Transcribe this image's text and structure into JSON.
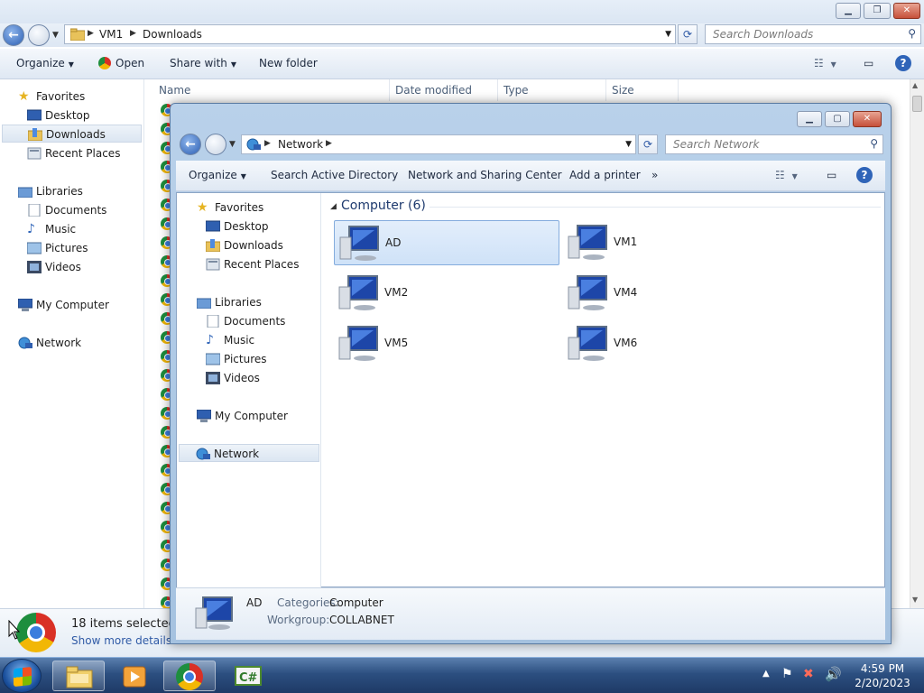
{
  "back_window": {
    "breadcrumb": [
      "VM1",
      "Downloads"
    ],
    "search_placeholder": "Search Downloads",
    "toolbar": {
      "organize": "Organize",
      "open": "Open",
      "share_with": "Share with",
      "new_folder": "New folder"
    },
    "nav": {
      "favorites": "Favorites",
      "desktop": "Desktop",
      "downloads": "Downloads",
      "recent_places": "Recent Places",
      "libraries": "Libraries",
      "documents": "Documents",
      "music": "Music",
      "pictures": "Pictures",
      "videos": "Videos",
      "my_computer": "My Computer",
      "network": "Network"
    },
    "columns": {
      "name": "Name",
      "date_modified": "Date modified",
      "type": "Type",
      "size": "Size"
    },
    "file_icon": "chrome-icon",
    "file_icon_count": 28,
    "details": {
      "selected": "18 items selected",
      "show_more": "Show more details..."
    }
  },
  "front_window": {
    "breadcrumb": [
      "Network"
    ],
    "search_placeholder": "Search Network",
    "toolbar": {
      "organize": "Organize",
      "search_ad": "Search Active Directory",
      "network_sharing": "Network and Sharing Center",
      "add_printer": "Add a printer",
      "more": "»"
    },
    "nav": {
      "favorites": "Favorites",
      "desktop": "Desktop",
      "downloads": "Downloads",
      "recent_places": "Recent Places",
      "libraries": "Libraries",
      "documents": "Documents",
      "music": "Music",
      "pictures": "Pictures",
      "videos": "Videos",
      "my_computer": "My Computer",
      "network": "Network"
    },
    "group_header": "Computer (6)",
    "computers": [
      {
        "name": "AD",
        "selected": true
      },
      {
        "name": "VM1",
        "selected": false
      },
      {
        "name": "VM2",
        "selected": false
      },
      {
        "name": "VM4",
        "selected": false
      },
      {
        "name": "VM5",
        "selected": false
      },
      {
        "name": "VM6",
        "selected": false
      }
    ],
    "details": {
      "name": "AD",
      "categories_label": "Categories:",
      "categories_value": "Computer",
      "workgroup_label": "Workgroup:",
      "workgroup_value": "COLLABNET"
    }
  },
  "taskbar": {
    "apps": [
      "explorer-icon",
      "media-player-icon",
      "chrome-icon",
      "csharp-icon"
    ],
    "time": "4:59 PM",
    "date": "2/20/2023"
  },
  "colors": {
    "selection": "#cfe2f8",
    "accent": "#2c5fb3",
    "taskbar": "#2c4f80"
  }
}
